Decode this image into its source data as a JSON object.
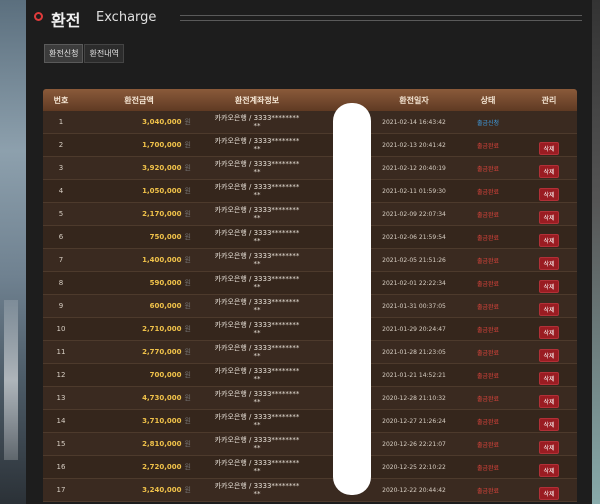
{
  "header": {
    "title_kr": "환전",
    "title_en": "Excharge"
  },
  "tabs": [
    "환전신청",
    "환전내역"
  ],
  "columns": [
    "번호",
    "환전금액",
    "환전계좌정보",
    "환전일자",
    "상태",
    "관리"
  ],
  "amount_unit": "원",
  "status_colors": {
    "pending": "#3fa0e6",
    "done": "#e0443c"
  },
  "delete_label": "삭제",
  "rows": [
    {
      "no": "1",
      "amount": "3,040,000",
      "account": "카카오은행 / 3333********",
      "acct2": "**",
      "date": "2021-02-14 16:43:42",
      "status": "출금신청",
      "status_type": "pending",
      "action": ""
    },
    {
      "no": "2",
      "amount": "1,700,000",
      "account": "카카오은행 / 3333********",
      "acct2": "**",
      "date": "2021-02-13 20:41:42",
      "status": "출금완료",
      "status_type": "done",
      "action": "삭제"
    },
    {
      "no": "3",
      "amount": "3,920,000",
      "account": "카카오은행 / 3333********",
      "acct2": "**",
      "date": "2021-02-12 20:40:19",
      "status": "출금완료",
      "status_type": "done",
      "action": "삭제"
    },
    {
      "no": "4",
      "amount": "1,050,000",
      "account": "카카오은행 / 3333********",
      "acct2": "**",
      "date": "2021-02-11 01:59:30",
      "status": "출금완료",
      "status_type": "done",
      "action": "삭제"
    },
    {
      "no": "5",
      "amount": "2,170,000",
      "account": "카카오은행 / 3333********",
      "acct2": "**",
      "date": "2021-02-09 22:07:34",
      "status": "출금완료",
      "status_type": "done",
      "action": "삭제"
    },
    {
      "no": "6",
      "amount": "750,000",
      "account": "카카오은행 / 3333********",
      "acct2": "**",
      "date": "2021-02-06 21:59:54",
      "status": "출금완료",
      "status_type": "done",
      "action": "삭제"
    },
    {
      "no": "7",
      "amount": "1,400,000",
      "account": "카카오은행 / 3333********",
      "acct2": "**",
      "date": "2021-02-05 21:51:26",
      "status": "출금완료",
      "status_type": "done",
      "action": "삭제"
    },
    {
      "no": "8",
      "amount": "590,000",
      "account": "카카오은행 / 3333********",
      "acct2": "**",
      "date": "2021-02-01 22:22:34",
      "status": "출금완료",
      "status_type": "done",
      "action": "삭제"
    },
    {
      "no": "9",
      "amount": "600,000",
      "account": "카카오은행 / 3333********",
      "acct2": "**",
      "date": "2021-01-31 00:37:05",
      "status": "출금완료",
      "status_type": "done",
      "action": "삭제"
    },
    {
      "no": "10",
      "amount": "2,710,000",
      "account": "카카오은행 / 3333********",
      "acct2": "**",
      "date": "2021-01-29 20:24:47",
      "status": "출금완료",
      "status_type": "done",
      "action": "삭제"
    },
    {
      "no": "11",
      "amount": "2,770,000",
      "account": "카카오은행 / 3333********",
      "acct2": "**",
      "date": "2021-01-28 21:23:05",
      "status": "출금완료",
      "status_type": "done",
      "action": "삭제"
    },
    {
      "no": "12",
      "amount": "700,000",
      "account": "카카오은행 / 3333********",
      "acct2": "**",
      "date": "2021-01-21 14:52:21",
      "status": "출금완료",
      "status_type": "done",
      "action": "삭제"
    },
    {
      "no": "13",
      "amount": "4,730,000",
      "account": "카카오은행 / 3333********",
      "acct2": "**",
      "date": "2020-12-28 21:10:32",
      "status": "출금완료",
      "status_type": "done",
      "action": "삭제"
    },
    {
      "no": "14",
      "amount": "3,710,000",
      "account": "카카오은행 / 3333********",
      "acct2": "**",
      "date": "2020-12-27 21:26:24",
      "status": "출금완료",
      "status_type": "done",
      "action": "삭제"
    },
    {
      "no": "15",
      "amount": "2,810,000",
      "account": "카카오은행 / 3333********",
      "acct2": "**",
      "date": "2020-12-26 22:21:07",
      "status": "출금완료",
      "status_type": "done",
      "action": "삭제"
    },
    {
      "no": "16",
      "amount": "2,720,000",
      "account": "카카오은행 / 3333********",
      "acct2": "**",
      "date": "2020-12-25 22:10:22",
      "status": "출금완료",
      "status_type": "done",
      "action": "삭제"
    },
    {
      "no": "17",
      "amount": "3,240,000",
      "account": "카카오은행 / 3333********",
      "acct2": "**",
      "date": "2020-12-22 20:44:42",
      "status": "출금완료",
      "status_type": "done",
      "action": "삭제"
    }
  ]
}
